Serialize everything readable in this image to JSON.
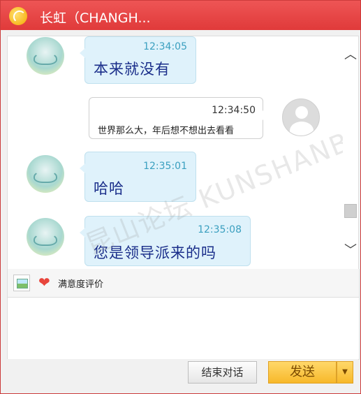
{
  "window": {
    "title": "长虹（CHANGH..."
  },
  "messages": [
    {
      "sender": "agent",
      "time": "12:34:05",
      "text": "本来就没有"
    },
    {
      "sender": "user",
      "time": "12:34:50",
      "text": "世界那么大，年后想不想出去看看"
    },
    {
      "sender": "agent",
      "time": "12:35:01",
      "text": "哈哈"
    },
    {
      "sender": "agent",
      "time": "12:35:08",
      "text": "您是领导派来的吗"
    }
  ],
  "watermark": "昆山论坛 KUNSHANBBS",
  "toolbar": {
    "image_icon": "image-icon",
    "heart_icon": "heart-icon",
    "rating_label": "满意度评价"
  },
  "input": {
    "value": ""
  },
  "actions": {
    "end_label": "结束对话",
    "send_label": "发送",
    "send_dropdown_icon": "▼"
  },
  "colors": {
    "titlebar": "#e84a4a",
    "agent_bubble": "#dff2fb",
    "agent_timestamp": "#3a9fbf",
    "agent_text": "#1a2e8a",
    "send_button": "#f7b82a"
  }
}
